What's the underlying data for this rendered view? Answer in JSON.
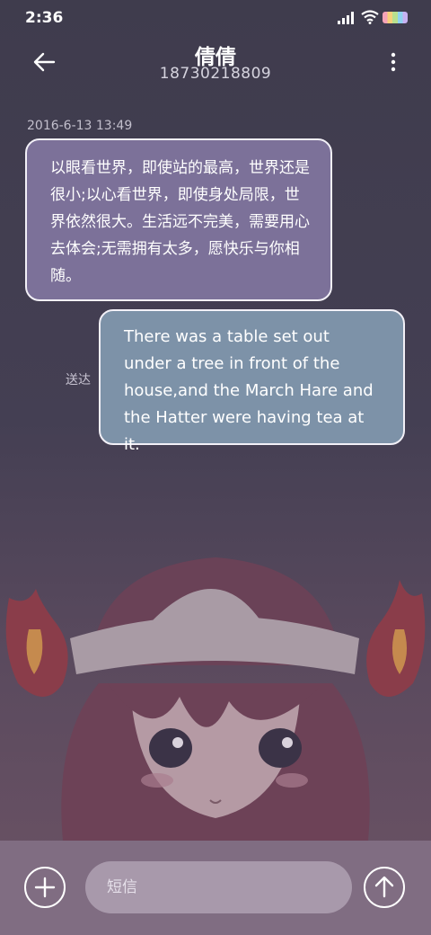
{
  "status_bar": {
    "time": "2:36"
  },
  "header": {
    "contact_name": "倩倩",
    "phone": "18730218809"
  },
  "messages": {
    "timestamp": "2016-6-13 13:49",
    "received_text": "以眼看世界，即使站的最高，世界还是很小;以心看世界，即使身处局限，世界依然很大。生活远不完美，需要用心去体会;无需拥有太多，愿快乐与你相随。",
    "sent_text": "There was a table set out under a tree in front of the house,and the March Hare and the Hatter were having tea at it.",
    "sent_status": "送达"
  },
  "composer": {
    "placeholder": "短信"
  },
  "icons": {
    "back": "arrow-left-icon",
    "more": "more-vertical-icon",
    "add": "plus-icon",
    "send": "arrow-up-icon"
  },
  "colors": {
    "received_bubble": "#7c7199",
    "sent_bubble": "#7d92a8",
    "background": "#3f3c4d"
  }
}
